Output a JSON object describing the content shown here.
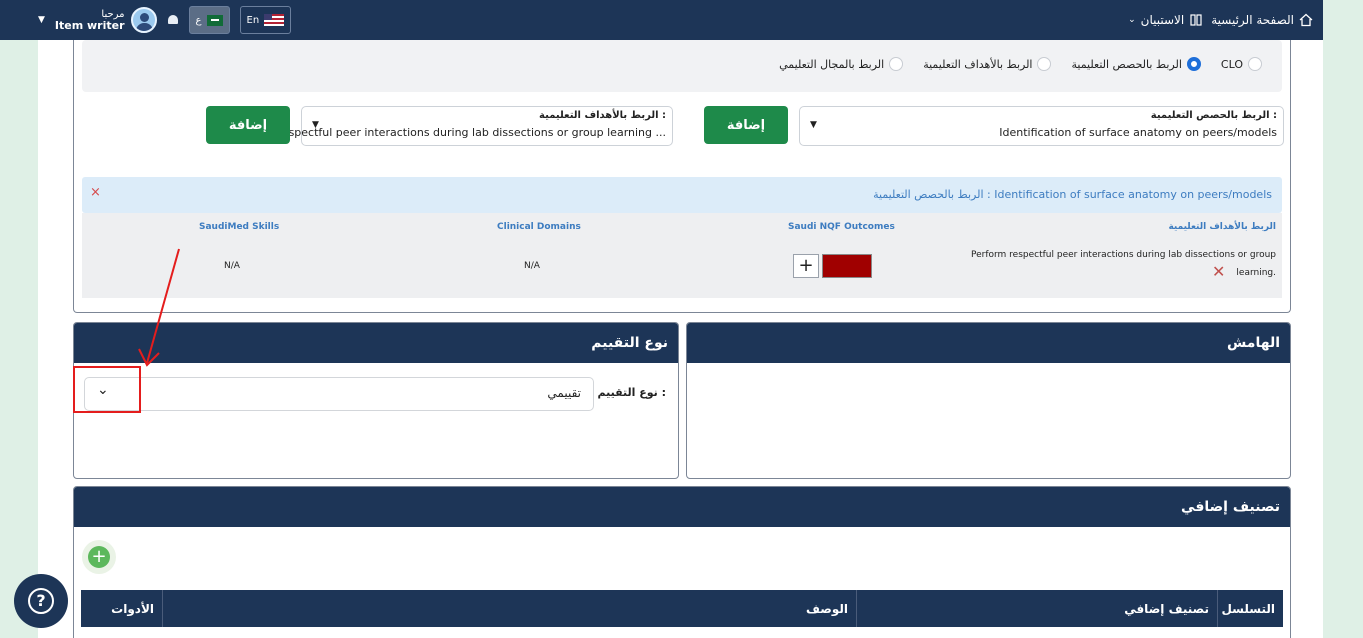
{
  "topbar": {
    "home_label": "الصفحة الرئيسية",
    "questionnaire_label": "الاستبيان",
    "greeting": "مرحبا",
    "user_role": "Item writer",
    "lang_ar": "ع",
    "lang_en": "En"
  },
  "linking": {
    "radios": [
      {
        "label": "CLO",
        "selected": false
      },
      {
        "label": "الربط بالحصص التعليمية",
        "selected": true
      },
      {
        "label": "الربط بالأهداف التعليمية",
        "selected": false
      },
      {
        "label": "الربط بالمجال التعليمي",
        "selected": false
      }
    ],
    "lessons_select": {
      "label": "الربط بالحصص التعليمية :",
      "value": "Identification of surface anatomy on peers/models"
    },
    "objectives_select": {
      "label": "الربط بالأهداف التعليمية :",
      "value": "respectful peer interactions during lab dissections or group learning ..."
    },
    "add_label": "إضافة",
    "info_text": "الربط بالحصص التعليمية : Identification of surface anatomy on peers/models",
    "close_glyph": "×",
    "table": {
      "headers": [
        "الربط بالأهداف التعليمية",
        "Saudi NQF Outcomes",
        "Clinical Domains",
        "SaudiMed Skills"
      ],
      "row": {
        "objective_line1": "Perform respectful peer interactions during lab dissections or group",
        "objective_line2": "learning.",
        "clinical_domains": "N/A",
        "saudimed_skills": "N/A",
        "plus_glyph": "+",
        "delete_glyph": "✕"
      }
    }
  },
  "margin_card": {
    "title": "الهامش"
  },
  "assessment_card": {
    "title": "نوع التقييم",
    "field_label": "نوع التقييم :",
    "field_value": "تقييمي"
  },
  "extra_card": {
    "title": "تصنيف إضافي",
    "add_glyph": "+",
    "columns": [
      "التسلسل",
      "تصنيف إضافي",
      "الوصف",
      "الأدوات"
    ]
  },
  "help_glyph": "?",
  "colors": {
    "nav": "#1d3557",
    "accent_green": "#1e8a4a",
    "highlight_red": "#e41d1d"
  }
}
